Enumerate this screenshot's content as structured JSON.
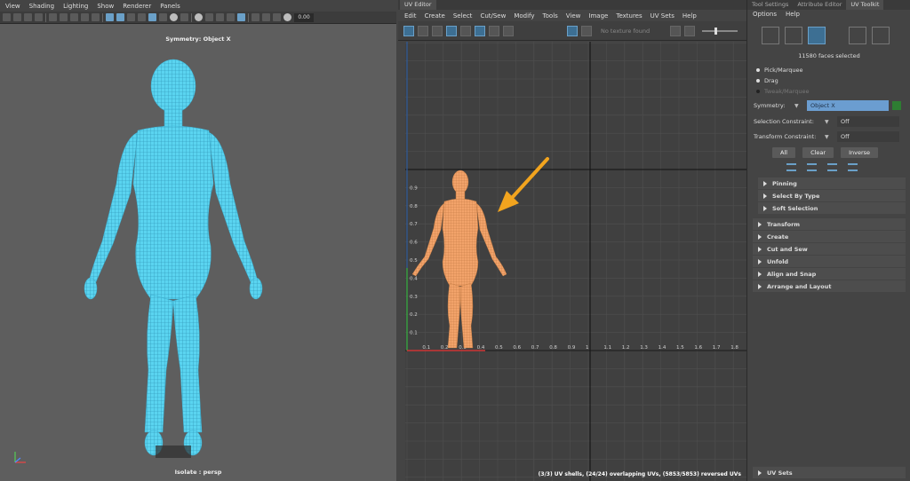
{
  "left": {
    "menu": [
      "View",
      "Shading",
      "Lighting",
      "Show",
      "Renderer",
      "Panels"
    ],
    "zoom_value": "0.00",
    "caption_top": "Symmetry: Object X",
    "caption_bottom": "Isolate : persp"
  },
  "uv_editor": {
    "tab_label": "UV Editor",
    "menu": [
      "Edit",
      "Create",
      "Select",
      "Cut/Sew",
      "Modify",
      "Tools",
      "View",
      "Image",
      "Textures",
      "UV Sets",
      "Help"
    ],
    "texture_field": "No texture found",
    "grid_labels_top": [
      "0.9",
      "0.8",
      "0.7",
      "0.6",
      "0.5",
      "0.4",
      "0.3",
      "0.2",
      "0.1"
    ],
    "grid_labels_axis_x": [
      "0.1",
      "0.2",
      "0.3",
      "0.4",
      "0.5",
      "0.6",
      "0.7",
      "0.8",
      "0.9",
      "1",
      "1.1",
      "1.2",
      "1.3",
      "1.4",
      "1.5",
      "1.6",
      "1.7",
      "1.8"
    ],
    "status": "(3/3) UV shells, (24/24) overlapping UVs, (5853/5853) reversed UVs"
  },
  "right": {
    "tabs": [
      {
        "label": "Tool Settings",
        "active": false
      },
      {
        "label": "Attribute Editor",
        "active": false
      },
      {
        "label": "UV Toolkit",
        "active": true
      }
    ],
    "menu": [
      "Options",
      "Help"
    ],
    "faces_selected": "11580 faces selected",
    "modes": [
      {
        "label": "Pick/Marquee",
        "enabled": true
      },
      {
        "label": "Drag",
        "enabled": true
      },
      {
        "label": "Tweak/Marquee",
        "enabled": false
      }
    ],
    "symmetry": {
      "label": "Symmetry:",
      "value": "Object X"
    },
    "selection_constraint": {
      "label": "Selection Constraint:",
      "value": "Off"
    },
    "transform_constraint": {
      "label": "Transform Constraint:",
      "value": "Off"
    },
    "buttons": {
      "all": "All",
      "clear": "Clear",
      "inverse": "Inverse"
    },
    "sub_sections": [
      "Pinning",
      "Select By Type",
      "Soft Selection"
    ],
    "sections": [
      "Transform",
      "Create",
      "Cut and Sew",
      "Unfold",
      "Align and Snap",
      "Arrange and Layout"
    ],
    "uv_sets": "UV Sets"
  },
  "colors": {
    "wire_mesh": "#5ad4f0",
    "uv_shell": "#f2a36a",
    "arrow": "#f2a41e",
    "selection_blue": "#6b9dd0"
  }
}
